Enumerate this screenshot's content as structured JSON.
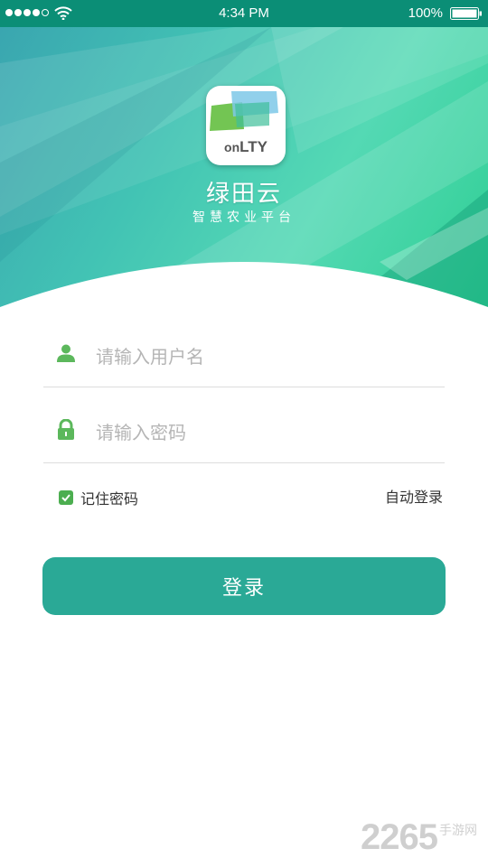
{
  "status_bar": {
    "time": "4:34 PM",
    "battery": "100%",
    "icons": [
      "signal-dots-icon",
      "wifi-icon",
      "battery-icon"
    ]
  },
  "header": {
    "logo": {
      "on": "on",
      "brand": "LTY"
    },
    "app_name": "绿田云",
    "slogan": "智慧农业平台"
  },
  "form": {
    "username": {
      "placeholder": "请输入用户名",
      "value": "",
      "icon": "user-icon"
    },
    "password": {
      "placeholder": "请输入密码",
      "value": "",
      "icon": "lock-icon"
    },
    "remember_password": {
      "label": "记住密码",
      "checked": true
    },
    "auto_login": "自动登录",
    "login_button": "登录"
  },
  "watermark": {
    "number": "2265",
    "site": "手游网"
  },
  "colors": {
    "accent": "#2aa996",
    "status_bar": "#0b8e76",
    "checkbox": "#4cae50",
    "icon_green": "#5cb85c"
  }
}
